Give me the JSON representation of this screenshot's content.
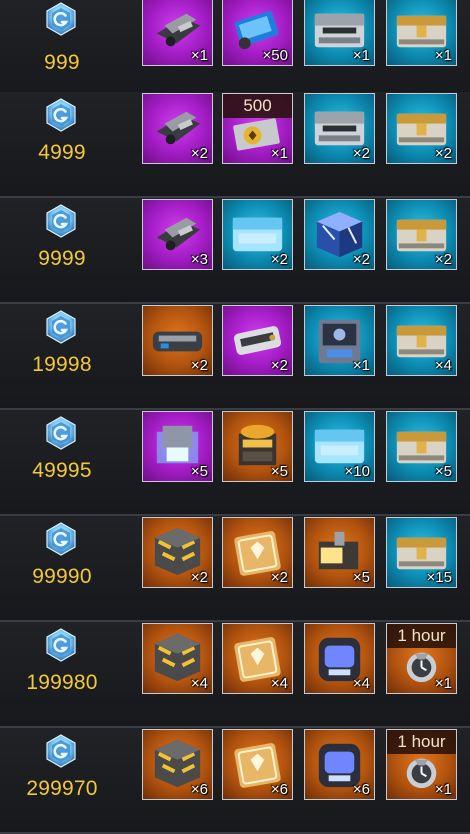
{
  "tiers": [
    {
      "points": "999",
      "rewards": [
        {
          "rarity": "purple",
          "item": "parts-bundle-icon",
          "qty": "×1"
        },
        {
          "rarity": "purple",
          "item": "blue-crystal-block-icon",
          "qty": "×50"
        },
        {
          "rarity": "blue",
          "item": "silver-chest-icon",
          "qty": "×1"
        },
        {
          "rarity": "blue",
          "item": "gold-chest-icon",
          "qty": "×1"
        }
      ]
    },
    {
      "points": "4999",
      "rewards": [
        {
          "rarity": "purple",
          "item": "parts-bundle-icon",
          "qty": "×2"
        },
        {
          "rarity": "purple",
          "item": "gold-ticket-icon",
          "qty": "×1",
          "tag": "500"
        },
        {
          "rarity": "blue",
          "item": "silver-chest-icon",
          "qty": "×2"
        },
        {
          "rarity": "blue",
          "item": "gold-chest-icon",
          "qty": "×2"
        }
      ]
    },
    {
      "points": "9999",
      "rewards": [
        {
          "rarity": "purple",
          "item": "parts-bundle-icon",
          "qty": "×3"
        },
        {
          "rarity": "blue",
          "item": "ice-chest-icon",
          "qty": "×2"
        },
        {
          "rarity": "blue",
          "item": "crystal-cube-icon",
          "qty": "×2"
        },
        {
          "rarity": "blue",
          "item": "gold-chest-icon",
          "qty": "×2"
        }
      ]
    },
    {
      "points": "19998",
      "rewards": [
        {
          "rarity": "orange",
          "item": "armor-plate-icon",
          "qty": "×2"
        },
        {
          "rarity": "purple",
          "item": "weapon-module-icon",
          "qty": "×2"
        },
        {
          "rarity": "blue",
          "item": "tech-box-icon",
          "qty": "×1"
        },
        {
          "rarity": "blue",
          "item": "gold-chest-icon",
          "qty": "×4"
        }
      ]
    },
    {
      "points": "49995",
      "rewards": [
        {
          "rarity": "purple",
          "item": "glowing-crate-icon",
          "qty": "×5"
        },
        {
          "rarity": "orange",
          "item": "golden-container-icon",
          "qty": "×5"
        },
        {
          "rarity": "blue",
          "item": "ice-chest-icon",
          "qty": "×10"
        },
        {
          "rarity": "blue",
          "item": "gold-chest-icon",
          "qty": "×5"
        }
      ]
    },
    {
      "points": "99990",
      "rewards": [
        {
          "rarity": "orange",
          "item": "hazard-cube-icon",
          "qty": "×2"
        },
        {
          "rarity": "orange",
          "item": "emblem-card-icon",
          "qty": "×2"
        },
        {
          "rarity": "orange",
          "item": "light-crate-icon",
          "qty": "×5"
        },
        {
          "rarity": "blue",
          "item": "gold-chest-icon",
          "qty": "×15"
        }
      ]
    },
    {
      "points": "199980",
      "rewards": [
        {
          "rarity": "orange",
          "item": "hazard-cube-icon",
          "qty": "×4"
        },
        {
          "rarity": "orange",
          "item": "emblem-card-icon",
          "qty": "×4"
        },
        {
          "rarity": "orange",
          "item": "neon-capsule-icon",
          "qty": "×4"
        },
        {
          "rarity": "orange",
          "item": "speedup-timer-icon",
          "qty": "×1",
          "tag": "1 hour"
        }
      ]
    },
    {
      "points": "299970",
      "rewards": [
        {
          "rarity": "orange",
          "item": "hazard-cube-icon",
          "qty": "×6"
        },
        {
          "rarity": "orange",
          "item": "emblem-card-icon",
          "qty": "×6"
        },
        {
          "rarity": "orange",
          "item": "neon-capsule-icon",
          "qty": "×6"
        },
        {
          "rarity": "orange",
          "item": "speedup-timer-icon",
          "qty": "×1",
          "tag": "1 hour"
        }
      ]
    }
  ],
  "colors": {
    "points": "#f3c83a",
    "purple": "#b52ad6",
    "blue": "#0f98c0",
    "orange": "#c45d12"
  }
}
